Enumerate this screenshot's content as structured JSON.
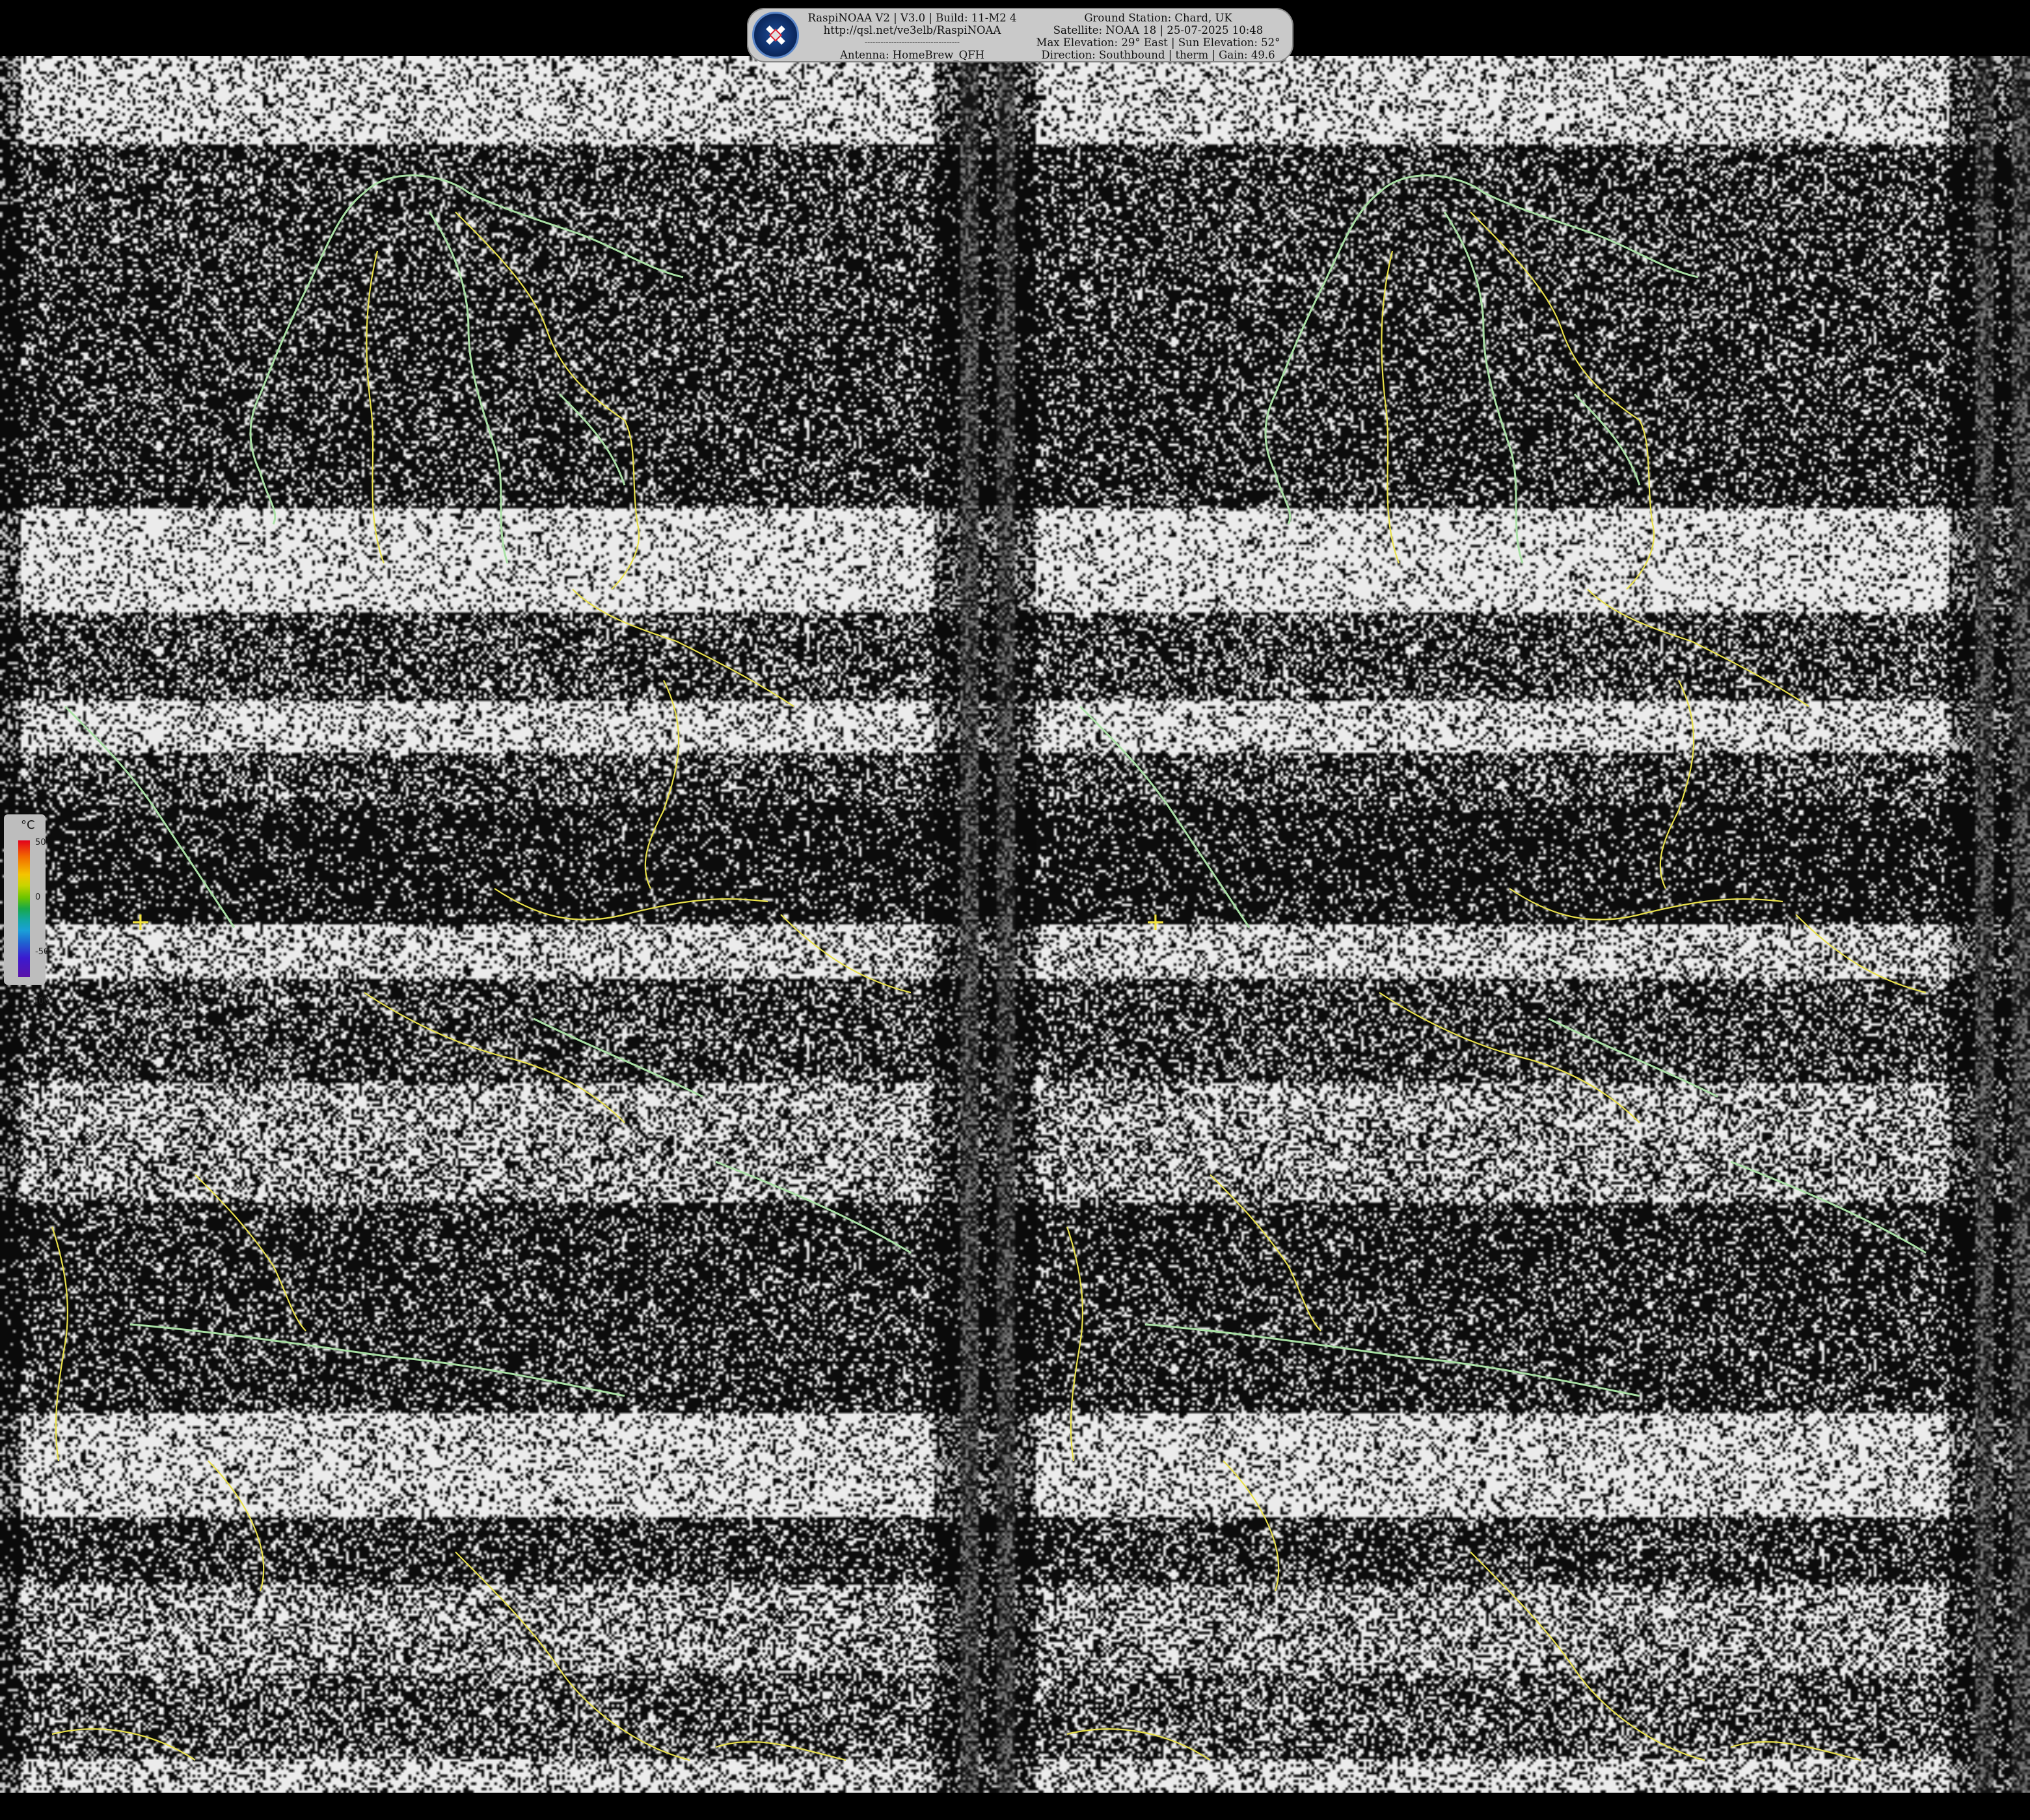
{
  "header": {
    "left": {
      "line1": "RaspiNOAA V2 | V3.0 | Build: 11-M2 4",
      "line2": "http://qsl.net/ve3elb/RaspiNOAA",
      "line3": "------------------------------------",
      "line4": "Antenna: HomeBrew_QFH"
    },
    "right": {
      "line1": "Ground Station: Chard, UK",
      "line2": "Satellite: NOAA 18 | 25-07-2025 10:48",
      "line3": "Max Elevation: 29° East | Sun Elevation: 52°",
      "line4": "Direction: Southbound | therm | Gain: 49.6"
    },
    "logo_icon": "satellite-icon"
  },
  "legend": {
    "unit": "°C",
    "ticks": [
      "50",
      "0",
      "-50",
      "-100"
    ]
  },
  "colors": {
    "coastline": "#a8e0a4",
    "borders": "#e8e04a",
    "marker": "#f2e23a"
  }
}
